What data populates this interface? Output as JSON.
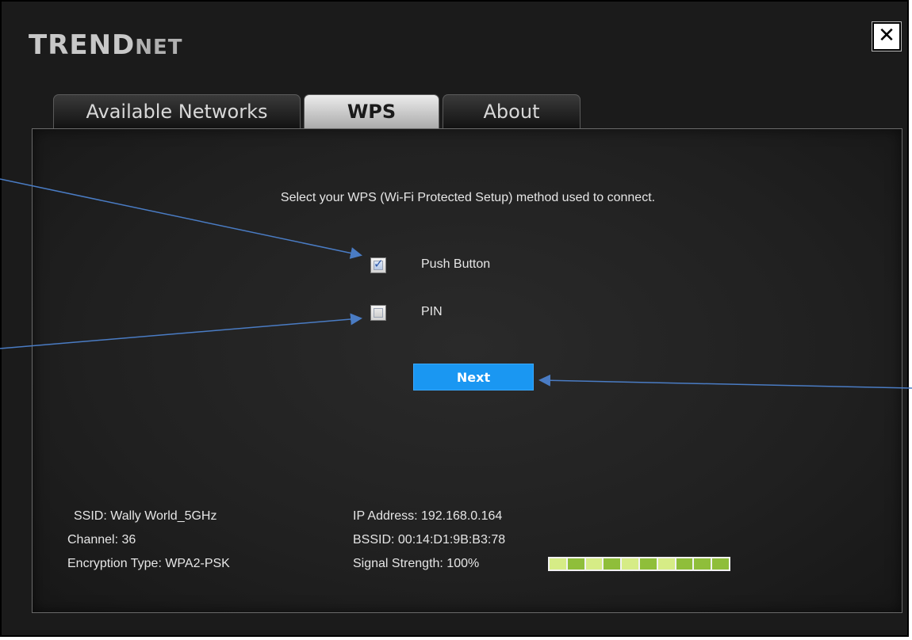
{
  "window": {
    "logo_upper": "TREND",
    "logo_lower": "NET",
    "close_glyph": "✕"
  },
  "tabs": [
    {
      "label": "Available Networks",
      "active": false
    },
    {
      "label": "WPS",
      "active": true
    },
    {
      "label": "About",
      "active": false
    }
  ],
  "wps": {
    "instruction": "Select your WPS (Wi-Fi Protected Setup) method used to connect.",
    "options": [
      {
        "label": "Push Button",
        "checked": true
      },
      {
        "label": "PIN",
        "checked": false
      }
    ],
    "next_label": "Next"
  },
  "status": {
    "ssid": "SSID:  Wally World_5GHz",
    "channel": "Channel:  36",
    "encryption": "Encryption Type:  WPA2-PSK",
    "ip": "IP Address:  192.168.0.164",
    "bssid": "BSSID: 00:14:D1:9B:B3:78",
    "signal": "Signal Strength:  100%",
    "signal_percent": 100
  },
  "colors": {
    "accent": "#1a97f2",
    "annotation_arrow": "#4a7cc4",
    "signal_green": "#8fbe3a"
  }
}
